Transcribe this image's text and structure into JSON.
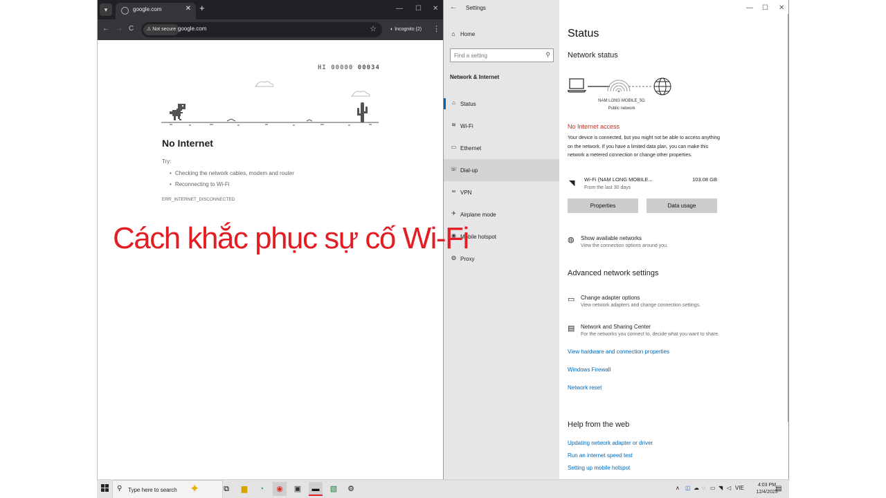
{
  "overlay_title": "Cách khắc phục sự cố Wi-Fi",
  "chrome": {
    "tab_menu_icon": "chevron-down-icon",
    "tab_title": "google.com",
    "tab_close": "✕",
    "new_tab": "+",
    "win_min": "—",
    "win_max": "☐",
    "win_close": "✕",
    "nav_back": "←",
    "nav_forward": "→",
    "nav_reload": "C",
    "security_label": "Not secure",
    "url": "google.com",
    "bookmark_icon": "☆",
    "incognito_label": "Incognito (2)",
    "menu_icon": "⋮",
    "dino_hi_label": "HI 00000",
    "dino_score": "00034",
    "page_title": "No Internet",
    "try_label": "Try:",
    "suggestions": [
      "Checking the network cables, modem and router",
      "Reconnecting to Wi-Fi"
    ],
    "error_code": "ERR_INTERNET_DISCONNECTED"
  },
  "settings": {
    "app_title": "Settings",
    "back_icon": "←",
    "home_label": "Home",
    "search_placeholder": "Find a setting",
    "section_title": "Network & Internet",
    "nav_items": [
      {
        "label": "Status",
        "icon": "⌂"
      },
      {
        "label": "Wi-Fi",
        "icon": "≋"
      },
      {
        "label": "Ethernet",
        "icon": "▭"
      },
      {
        "label": "Dial-up",
        "icon": "☏"
      },
      {
        "label": "VPN",
        "icon": "∞"
      },
      {
        "label": "Airplane mode",
        "icon": "✈"
      },
      {
        "label": "Mobile hotspot",
        "icon": "◉"
      },
      {
        "label": "Proxy",
        "icon": "◍"
      }
    ],
    "page_title": "Status",
    "network_status_heading": "Network status",
    "network_name": "NAM LONG MOBILE_5G",
    "network_type": "Public network",
    "no_internet_title": "No Internet access",
    "no_internet_desc": "Your device is connected, but you might not be able to access anything on the network. If you have a limited data plan, you can make this network a metered connection or change other properties.",
    "wifi_name": "Wi-Fi (NAM LONG MOBILE...",
    "wifi_sub": "From the last 30 days",
    "wifi_usage": "103.08 GB",
    "properties_button": "Properties",
    "data_usage_button": "Data usage",
    "show_networks_title": "Show available networks",
    "show_networks_desc": "View the connection options around you.",
    "advanced_heading": "Advanced network settings",
    "adapter_title": "Change adapter options",
    "adapter_desc": "View network adapters and change connection settings.",
    "sharing_title": "Network and Sharing Center",
    "sharing_desc": "For the networks you connect to, decide what you want to share.",
    "links": [
      "View hardware and connection properties",
      "Windows Firewall",
      "Network reset"
    ],
    "help_heading": "Help from the web",
    "help_links": [
      "Updating network adapter or driver",
      "Run an internet speed test",
      "Setting up mobile hotspot"
    ]
  },
  "taskbar": {
    "search_placeholder": "Type here to search",
    "language": "VIE",
    "time": "4:03 PM",
    "date": "12/4/2025"
  }
}
